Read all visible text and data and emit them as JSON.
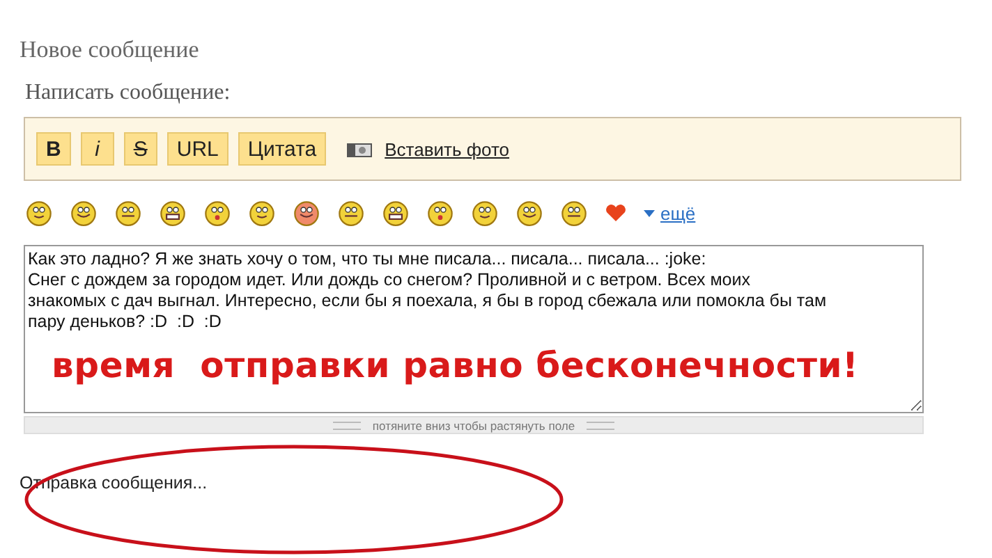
{
  "page_title": "Новое сообщение",
  "form_label": "Написать сообщение:",
  "toolbar": {
    "buttons": [
      {
        "label": "B",
        "kind": "bold"
      },
      {
        "label": "i",
        "kind": "italic"
      },
      {
        "label": "S",
        "kind": "strike"
      },
      {
        "label": "URL",
        "kind": "plain"
      },
      {
        "label": "Цитата",
        "kind": "plain"
      }
    ],
    "photo_link": "Вставить фото"
  },
  "smileys": {
    "more_link": "ещё"
  },
  "message": {
    "lines": [
      "Как это ладно? Я же знать хочу о том, что ты мне писала... писала... писала... :joke:",
      "Снег с дождем за городом идет. Или дождь со снегом? Проливной и с ветром. Всех моих",
      "знакомых с дач выгнал. Интересно, если бы я поехала, я бы в город сбежала или помокла бы там",
      "пару деньков? :D  :D  :D"
    ],
    "resize_hint": "потяните вниз чтобы растянуть поле"
  },
  "annotation": {
    "text": "время  отправки равно бесконечности!"
  },
  "status": "Отправка сообщения..."
}
